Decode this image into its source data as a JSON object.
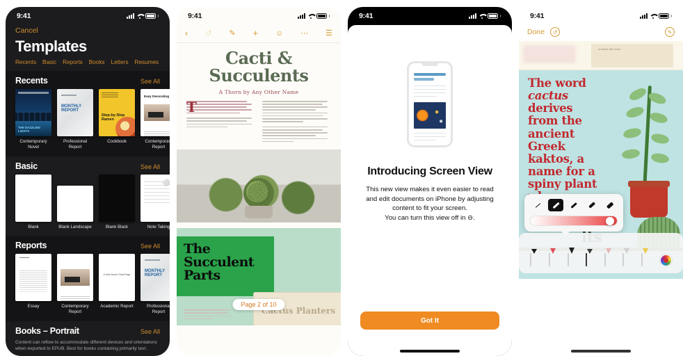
{
  "status_bar": {
    "time": "9:41",
    "signal_icon": "cellular-bars-icon",
    "wifi_icon": "wifi-icon",
    "battery_icon": "battery-icon"
  },
  "accent_color": "#d79a33",
  "button_color": "#ef8b22",
  "panel1": {
    "cancel_label": "Cancel",
    "title": "Templates",
    "categories": [
      "Recents",
      "Basic",
      "Reports",
      "Books",
      "Letters",
      "Resumes"
    ],
    "see_all_label": "See All",
    "sections": [
      {
        "heading": "Recents",
        "items": [
          {
            "name": "Contemporary\nNovel",
            "thumb": "novel-thumb",
            "cover_title": "THE\nDAZZLING\nLIGHTS"
          },
          {
            "name": "Professional\nReport",
            "thumb": "monthly-report-thumb",
            "cover_title": "MONTHLY\nREPORT"
          },
          {
            "name": "Cookbook",
            "thumb": "cookbook-thumb",
            "cover_title": "Step-by-Step\nRamen"
          },
          {
            "name": "Contemporary\nReport",
            "thumb": "contemporary-report-thumb",
            "cover_title": "Easy Decorating"
          }
        ]
      },
      {
        "heading": "Basic",
        "items": [
          {
            "name": "Blank",
            "thumb": "blank-thumb"
          },
          {
            "name": "Blank Landscape",
            "thumb": "blank-landscape-thumb"
          },
          {
            "name": "Blank Black",
            "thumb": "blank-black-thumb"
          },
          {
            "name": "Note Taking",
            "thumb": "note-taking-thumb"
          }
        ]
      },
      {
        "heading": "Reports",
        "items": [
          {
            "name": "Essay",
            "thumb": "essay-thumb"
          },
          {
            "name": "Contemporary\nReport",
            "thumb": "contemporary-report-thumb"
          },
          {
            "name": "Academic Report",
            "thumb": "academic-report-thumb",
            "cover_title": "A Little Above\nGreat Page"
          },
          {
            "name": "Professional\nReport",
            "thumb": "monthly-report-thumb",
            "cover_title": "MONTHLY\nREPORT"
          }
        ]
      }
    ],
    "books_section": {
      "heading": "Books – Portrait",
      "description": "Content can reflow to accommodate different devices and orientations when exported to EPUB. Best for books containing primarily text."
    }
  },
  "panel2": {
    "toolbar_icons": [
      "back-chevron-icon",
      "undo-icon",
      "markup-brush-icon",
      "add-icon",
      "collaborate-icon",
      "more-ellipsis-icon",
      "document-options-icon"
    ],
    "doc_title": "Cacti &\nSucculents",
    "doc_subtitle": "A Thorn by Any Other Name",
    "drop_cap": "T",
    "section_title": "The\nSucculent\nParts",
    "card_label": "Cactus Planters",
    "page_indicator": "Page 2 of 10"
  },
  "panel3": {
    "title": "Introducing Screen View",
    "body": "This new view makes it even easier to read and edit documents on iPhone by adjusting content to fit your screen.\nYou can turn this view off in ⊖.",
    "button_label": "Got It",
    "illustration": "iphone-screen-view-illustration"
  },
  "panel4": {
    "done_label": "Done",
    "undo_icon": "undo-circle-icon",
    "markup_icon": "markup-pen-circle-icon",
    "preview_note": "enabled with them",
    "page_text_before": "The word ",
    "page_text_em": "cactus",
    "page_text_after": " derives from the ancient Greek kaktos, a name for a spiny plant whose identity is not certain.",
    "big_word": "its",
    "tools": [
      "pen-tool",
      "marker-tool",
      "pencil-tool",
      "fill-tool",
      "eraser-tool",
      "lasso-tool",
      "highlighter-tool",
      "color-wheel-tool"
    ],
    "stroke_widths": [
      "stroke-thin",
      "stroke-selected",
      "stroke-medium",
      "stroke-thick",
      "stroke-thickest"
    ],
    "opacity_slider": "opacity-slider"
  }
}
